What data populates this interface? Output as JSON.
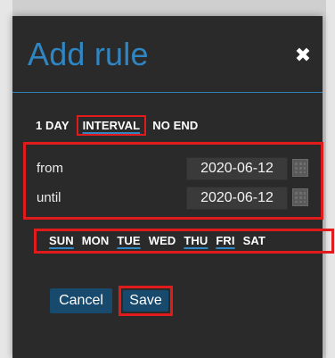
{
  "modal": {
    "title": "Add rule",
    "close_icon": "✖",
    "range_tabs": [
      {
        "label": "1 DAY"
      },
      {
        "label": "INTERVAL"
      },
      {
        "label": "NO END"
      }
    ],
    "dates": {
      "from_label": "from",
      "from_value": "2020-06-12",
      "until_label": "until",
      "until_value": "2020-06-12",
      "calendar_icon": "calendar-icon"
    },
    "days": [
      {
        "label": "SUN"
      },
      {
        "label": "MON"
      },
      {
        "label": "TUE"
      },
      {
        "label": "WED"
      },
      {
        "label": "THU"
      },
      {
        "label": "FRI"
      },
      {
        "label": "SAT"
      }
    ],
    "buttons": {
      "cancel": "Cancel",
      "save": "Save"
    },
    "colors": {
      "accent_blue": "#2f86c3",
      "highlight_red": "#e11b1b",
      "button_blue": "#174a6d",
      "modal_bg": "#2a2a2a"
    }
  }
}
